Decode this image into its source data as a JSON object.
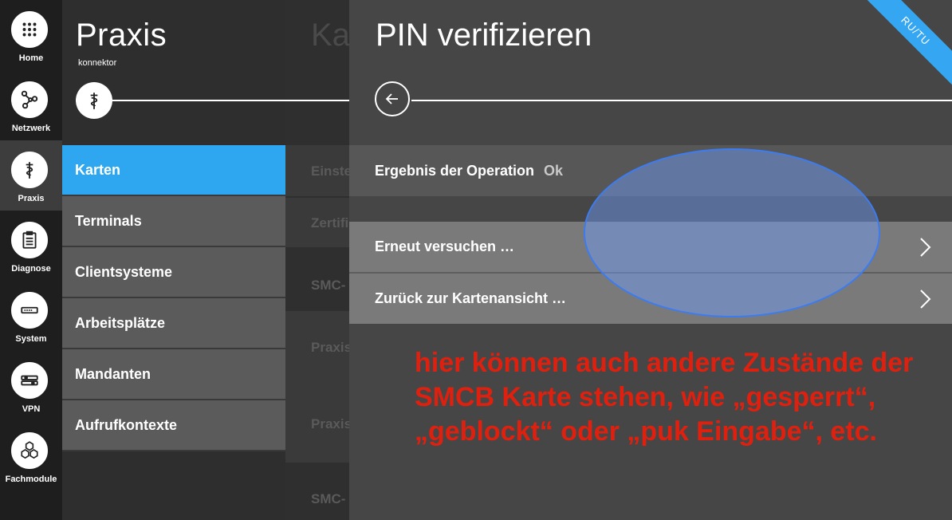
{
  "rail": {
    "items": [
      {
        "label": "Home",
        "icon": "grid-icon"
      },
      {
        "label": "Netzwerk",
        "icon": "network-icon"
      },
      {
        "label": "Praxis",
        "icon": "caduceus-icon"
      },
      {
        "label": "Diagnose",
        "icon": "clipboard-icon"
      },
      {
        "label": "System",
        "icon": "device-icon"
      },
      {
        "label": "VPN",
        "icon": "vpn-icon"
      },
      {
        "label": "Fachmodule",
        "icon": "hexagons-icon"
      }
    ],
    "active": "Praxis"
  },
  "menu": {
    "title": "Praxis",
    "subtitle": "konnektor",
    "items": [
      {
        "label": "Karten"
      },
      {
        "label": "Terminals"
      },
      {
        "label": "Clientsysteme"
      },
      {
        "label": "Arbeitsplätze"
      },
      {
        "label": "Mandanten"
      },
      {
        "label": "Aufrufkontexte"
      }
    ],
    "active": "Karten"
  },
  "background_panel": {
    "title": "Ka",
    "rows": [
      "Einste",
      "Zertifi",
      "SMC-",
      "Praxis",
      "Praxis",
      "SMC-"
    ]
  },
  "main": {
    "title": "PIN verifizieren",
    "result_label": "Ergebnis der Operation",
    "result_value": "Ok",
    "actions": [
      {
        "label": "Erneut versuchen …"
      },
      {
        "label": "Zurück zur Kartenansicht …"
      }
    ],
    "ribbon": "RU/TU"
  },
  "annotation": "hier können auch andere Zustände der SMCB Karte stehen, wie „gesperrt“, „geblockt“ oder „puk Eingabe“, etc.",
  "colors": {
    "accent": "#2ea7f0",
    "annotation_text": "#e0200f",
    "highlight_ellipse": "#6ea0ff"
  }
}
